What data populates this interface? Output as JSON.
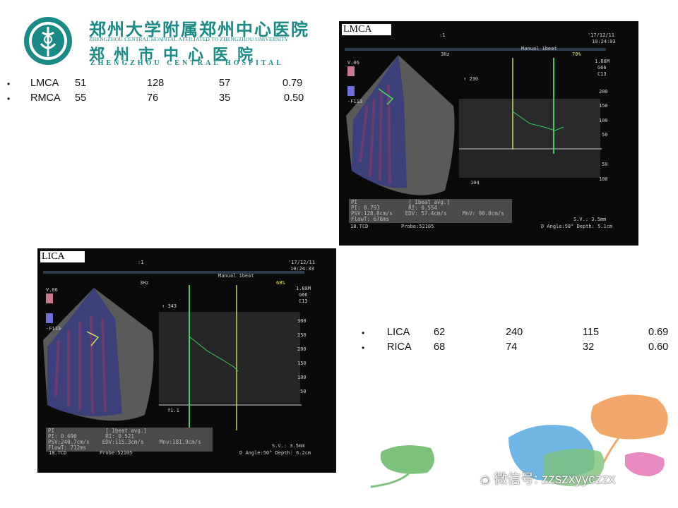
{
  "header": {
    "cn_title": "郑州大学附属郑州中心医院",
    "en_subtitle": "ZHENGZHOU CENTRAL HOSPITAL AFFILIATED TO ZHENGZHOU UNIVERSITY",
    "cn_title2": "郑州市中心医院",
    "en_title2": "ZHENGZHOU CENTRAL HOSPITAL"
  },
  "table_top": [
    {
      "name": "LMCA",
      "v1": "51",
      "v2": "128",
      "v3": "57",
      "v4": "0.79"
    },
    {
      "name": "RMCA",
      "v1": "55",
      "v2": "76",
      "v3": "35",
      "v4": "0.50"
    }
  ],
  "table_bottom": [
    {
      "name": "LICA",
      "v1": "62",
      "v2": "240",
      "v3": "115",
      "v4": "0.69"
    },
    {
      "name": "RICA",
      "v1": "68",
      "v2": "74",
      "v3": "32",
      "v4": "0.60"
    }
  ],
  "panel_lmca": {
    "label": "LMCA",
    "marker": ":1",
    "date": "'17/12/11",
    "time": "10:24:03",
    "mode": "Manual   1beat",
    "pct": "70%",
    "freq": "3Hz",
    "mhz": "1.88M",
    "g": "G66",
    "c": "C13",
    "v_top": "V.06",
    "v_bot": "-F113",
    "peak": "230",
    "scale": [
      "200",
      "150",
      "100",
      "50",
      "50",
      "100"
    ],
    "bottom_val": "104",
    "pi_line": "PI                [ 1beat avg.]",
    "pi_vals": "PI: 0.793         RI: 0.554",
    "psv": "PSV:128.8cm/s    EDV: 57.4cm/s     MnV: 90.0cm/s",
    "flowt": "FlowT: 676ms",
    "tcd": "18.TCD",
    "probe": "Probe:52105",
    "sv": "S.V.:   3.5mm",
    "dangle": "D Angle:58°  Depth:   5.1cm"
  },
  "panel_lica": {
    "label": "LICA",
    "marker": ":1",
    "date": "'17/12/11",
    "time": "10:24:33",
    "mode": "Manual   1beat",
    "pct": "68%",
    "freq": "3Hz",
    "mhz": "1.88M",
    "g": "G66",
    "c": "C13",
    "v_top": "V.06",
    "v_bot": "-F113",
    "peak": "343",
    "scale": [
      "300",
      "250",
      "200",
      "150",
      "100",
      "50"
    ],
    "bottom_val": "f1.1",
    "pi_line": "PI                [ 1beat avg.]",
    "pi_vals": "PI: 0.690         RI: 0.521",
    "psv": "PSV:240.7cm/s    EDV:115.3cm/s     Mnv:181.9cm/s",
    "flowt": "FlowT: 712ms",
    "tcd": "18.TCD",
    "probe": "Probe:52105",
    "sv": "S.V.:   3.5mm",
    "dangle": "D Angle:50°  Depth:   6.2cm"
  },
  "watermark": "微信号: zzszxyyczzx",
  "colors": {
    "teal": "#1a8a86",
    "ginkgo_orange": "#f2a86a",
    "ginkgo_blue": "#6fb6e4",
    "ginkgo_green": "#7cc27a",
    "ginkgo_pink": "#e98ac0"
  }
}
